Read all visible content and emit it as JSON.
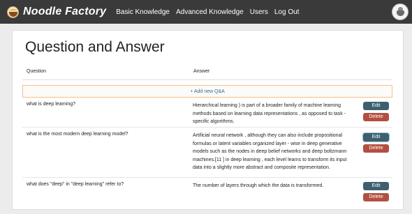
{
  "navbar": {
    "brand": "Noodle Factory",
    "links": [
      "Basic Knowledge",
      "Advanced Knowledge",
      "Users",
      "Log Out"
    ]
  },
  "page": {
    "title": "Question and Answer",
    "columns": {
      "question": "Question",
      "answer": "Answer"
    },
    "add_label": "+ Add new Q&A",
    "edit_label": "Edit",
    "delete_label": "Delete"
  },
  "rows": [
    {
      "question": "what is deep learning?",
      "answer_lines": [
        "Hierarchical learning ) is part of a broader family of machine learning",
        "methods based on learning data representations , as opposed to task -",
        "specific algorithms."
      ]
    },
    {
      "question": "what is the most modern deep learning model?",
      "answer_lines": [
        "Artificial neural network , although they can also include propositional",
        "formulas or latent variables organized layer - wise in deep generative",
        "models such as the nodes in deep belief networks and deep boltzmann",
        "machines.[11 ] in deep learning , each level learns to transform its input",
        "data into a slightly more abstract and composite representation."
      ]
    },
    {
      "question": "what does \"deep\" in \"deep learning\" refer to?",
      "answer_lines": [
        "The number of layers through which the data is transformed."
      ]
    }
  ],
  "colors": {
    "navbar": "#3a3a3a",
    "edit": "#3c6070",
    "delete": "#b2503f",
    "link": "#2f6f95"
  }
}
